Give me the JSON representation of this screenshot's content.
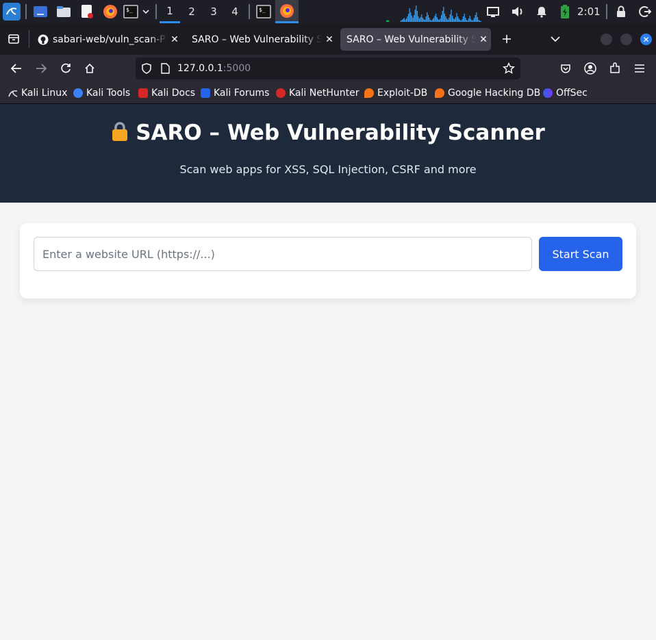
{
  "taskbar": {
    "workspaces": [
      "1",
      "2",
      "3",
      "4"
    ],
    "active_workspace": "1",
    "clock": "2:01",
    "icons": [
      "kali-menu-icon",
      "desktop-icon",
      "file-manager-icon",
      "text-editor-icon",
      "firefox-icon",
      "terminal-icon",
      "display-icon",
      "volume-icon",
      "notification-bell-icon",
      "battery-icon",
      "lock-icon",
      "logout-icon"
    ]
  },
  "browser": {
    "tabs": [
      {
        "title": "sabari-web/vuln_scan-Pr",
        "favicon": "github-icon",
        "selected": false
      },
      {
        "title": "SARO – Web Vulnerability Sc",
        "favicon": "",
        "selected": false
      },
      {
        "title": "SARO – Web Vulnerability Sc",
        "favicon": "",
        "selected": true
      }
    ],
    "url_host": "127.0.0.1",
    "url_port": ":5000",
    "bookmarks": [
      {
        "label": "Kali Linux",
        "icon": "kali-dragon-icon",
        "color": "#e6e6e6"
      },
      {
        "label": "Kali Tools",
        "icon": "kali-tools-icon",
        "color": "#3b82f6"
      },
      {
        "label": "Kali Docs",
        "icon": "kali-docs-icon",
        "color": "#d62828"
      },
      {
        "label": "Kali Forums",
        "icon": "kali-forums-icon",
        "color": "#2563eb"
      },
      {
        "label": "Kali NetHunter",
        "icon": "nethunter-icon",
        "color": "#d62828"
      },
      {
        "label": "Exploit-DB",
        "icon": "exploit-db-icon",
        "color": "#f97316"
      },
      {
        "label": "Google Hacking DB",
        "icon": "ghdb-icon",
        "color": "#f97316"
      },
      {
        "label": "OffSec",
        "icon": "offsec-icon",
        "color": "#7c3aed"
      }
    ]
  },
  "page": {
    "title": "SARO – Web Vulnerability Scanner",
    "title_icon": "lock-emoji-icon",
    "subtitle": "Scan web apps for XSS, SQL Injection, CSRF and more",
    "url_placeholder": "Enter a website URL (https://...)",
    "url_value": "",
    "scan_button": "Start Scan"
  },
  "colors": {
    "hero_bg": "#1e293b",
    "accent": "#2563eb",
    "page_bg": "#f5f5f5",
    "firefox_chrome": "#2b2a33",
    "taskbar_bg": "#1e1f26"
  }
}
